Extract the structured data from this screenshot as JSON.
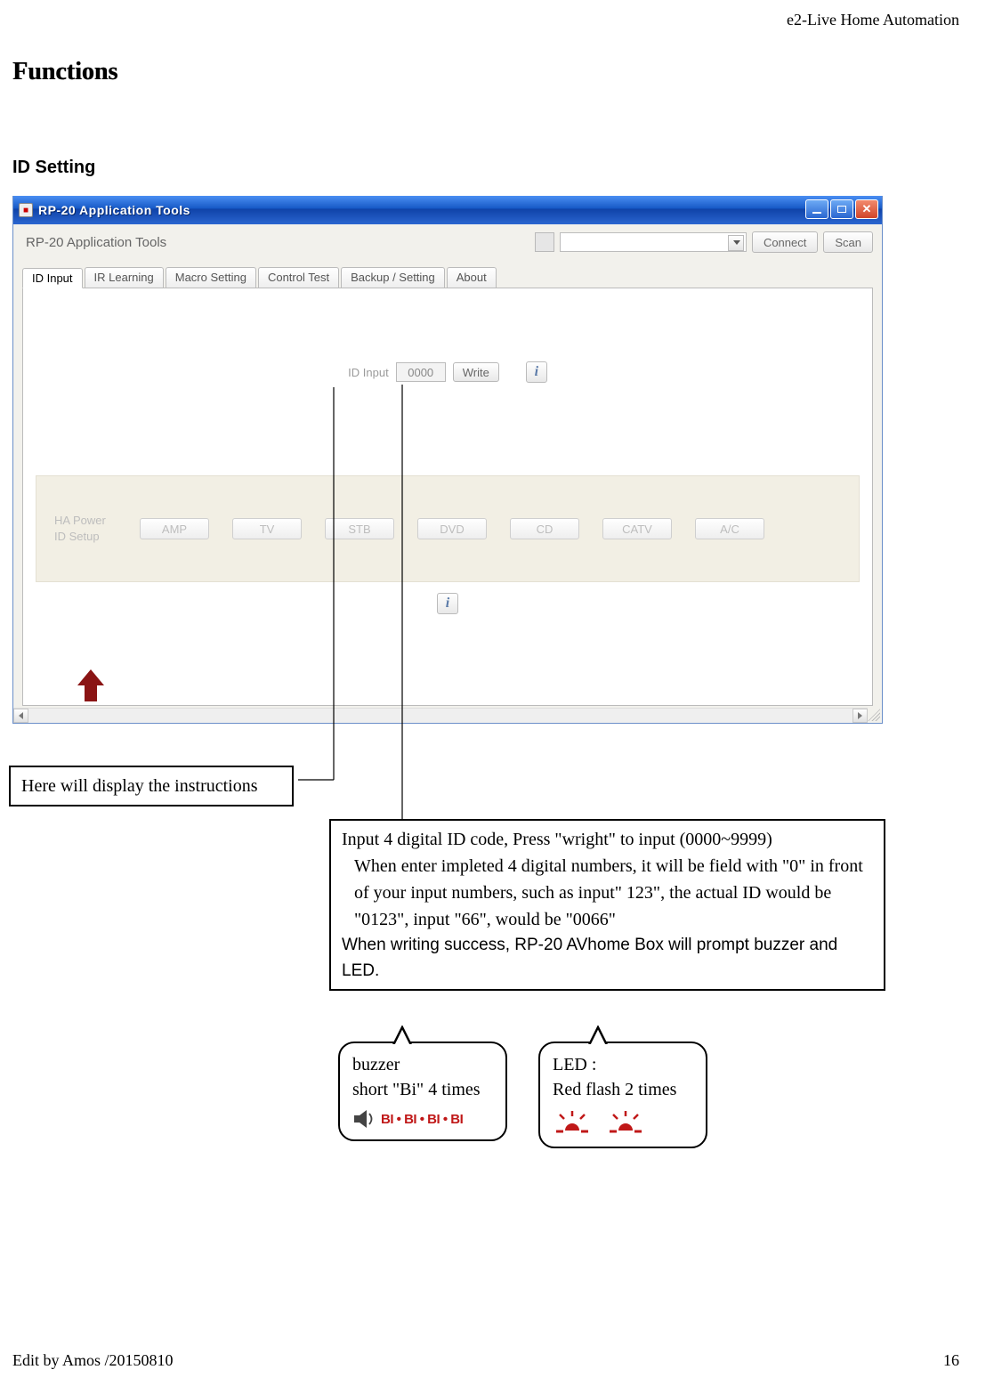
{
  "header": {
    "product": "e2-Live Home Automation"
  },
  "section": {
    "title": "Functions",
    "subsection": "ID Setting"
  },
  "window": {
    "title": "RP-20 Application Tools",
    "toolbar_label": "RP-20 Application Tools",
    "connect_btn": "Connect",
    "scan_btn": "Scan",
    "tabs": {
      "id_input": "ID Input",
      "ir_learning": "IR Learning",
      "macro": "Macro Setting",
      "control_test": "Control Test",
      "backup": "Backup / Setting",
      "about": "About"
    },
    "id_input_label": "ID Input",
    "id_value": "0000",
    "write_btn": "Write",
    "ha_label_line1": "HA Power",
    "ha_label_line2": "ID Setup",
    "ha_buttons": [
      "AMP",
      "TV",
      "STB",
      "DVD",
      "CD",
      "CATV",
      "A/C"
    ]
  },
  "callouts": {
    "instructions": "Here will display the instructions",
    "id_explain_l1": "Input 4 digital ID code, Press \"wright\" to input (0000~9999)",
    "id_explain_l2": "When enter impleted 4 digital numbers, it will be field with \"0\" in front of your input numbers, such as input\" 123\", the actual ID would be \"0123\", input \"66\", would be \"0066\"",
    "id_explain_l3": "When writing success, RP-20 AVhome Box will prompt buzzer and LED.",
    "buzzer_l1": "buzzer",
    "buzzer_l2": "short \"Bi\" 4 times",
    "buzzer_sound": "BI • BI • BI • BI",
    "led_l1": "LED :",
    "led_l2": "Red flash 2 times"
  },
  "footer": {
    "edit": "Edit by Amos /20150810",
    "page": "16"
  }
}
